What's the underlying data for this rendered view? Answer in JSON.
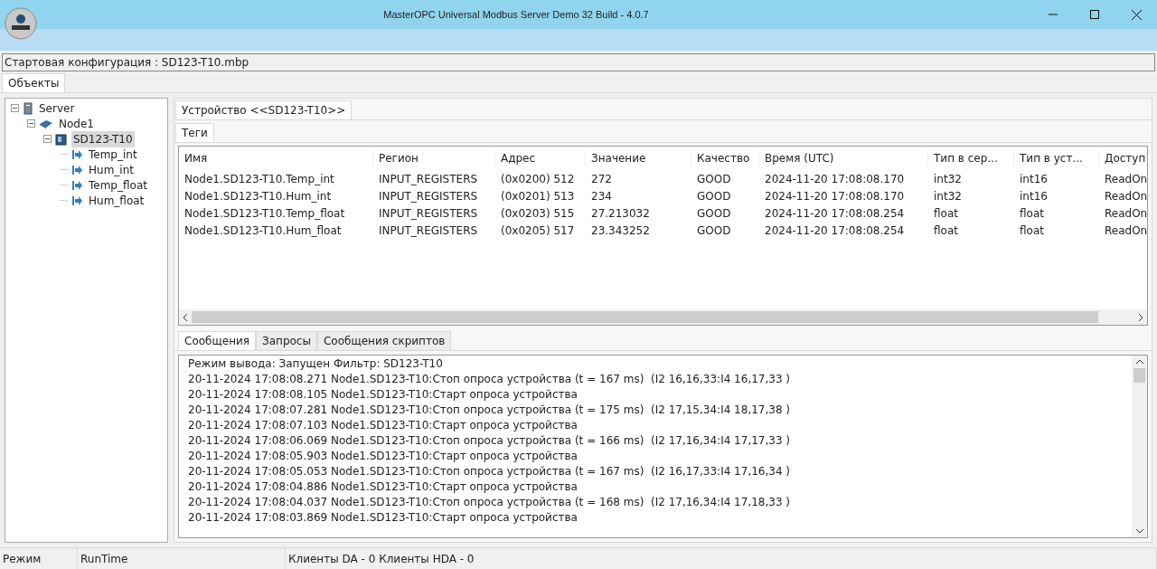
{
  "window": {
    "title": "MasterOPC Universal Modbus Server Demo 32 Build - 4.0.7"
  },
  "config_line": "Стартовая конфигурация : SD123-T10.mbp",
  "left_tabs": [
    {
      "label": "Объекты",
      "selected": true
    }
  ],
  "tree": [
    {
      "label": "Server",
      "kind": "server",
      "expanded": true,
      "selected": false,
      "children": [
        {
          "label": "Node1",
          "kind": "node",
          "expanded": true,
          "selected": false,
          "children": [
            {
              "label": "SD123-T10",
              "kind": "device",
              "expanded": true,
              "selected": true,
              "children": [
                {
                  "label": "Temp_int",
                  "kind": "tag",
                  "selected": false
                },
                {
                  "label": "Hum_int",
                  "kind": "tag",
                  "selected": false
                },
                {
                  "label": "Temp_float",
                  "kind": "tag",
                  "selected": false
                },
                {
                  "label": "Hum_float",
                  "kind": "tag",
                  "selected": false
                }
              ]
            }
          ]
        }
      ]
    }
  ],
  "device_tabs": [
    {
      "label": "Устройство <<SD123-T10>>",
      "selected": true
    }
  ],
  "tag_tabs": [
    {
      "label": "Теги",
      "selected": true
    }
  ],
  "table": {
    "columns": [
      "Имя",
      "Регион",
      "Адрес",
      "Значение",
      "Качество",
      "Время (UTC)",
      "Тип в сер...",
      "Тип в уст...",
      "Доступ"
    ],
    "rows": [
      [
        "Node1.SD123-T10.Temp_int",
        "INPUT_REGISTERS",
        "(0x0200) 512",
        "272",
        "GOOD",
        "2024-11-20 17:08:08.170",
        "int32",
        "int16",
        "ReadOn"
      ],
      [
        "Node1.SD123-T10.Hum_int",
        "INPUT_REGISTERS",
        "(0x0201) 513",
        "234",
        "GOOD",
        "2024-11-20 17:08:08.170",
        "int32",
        "int16",
        "ReadOn"
      ],
      [
        "Node1.SD123-T10.Temp_float",
        "INPUT_REGISTERS",
        "(0x0203) 515",
        "27.213032",
        "GOOD",
        "2024-11-20 17:08:08.254",
        "float",
        "float",
        "ReadOn"
      ],
      [
        "Node1.SD123-T10.Hum_float",
        "INPUT_REGISTERS",
        "(0x0205) 517",
        "23.343252",
        "GOOD",
        "2024-11-20 17:08:08.254",
        "float",
        "float",
        "ReadOn"
      ]
    ]
  },
  "log_tabs": [
    {
      "label": "Сообщения",
      "selected": true
    },
    {
      "label": "Запросы",
      "selected": false
    },
    {
      "label": "Сообщения скриптов",
      "selected": false
    }
  ],
  "log": {
    "header": "Режим вывода: Запущен Фильтр: SD123-T10",
    "lines": [
      "20-11-2024 17:08:08.271 Node1.SD123-T10:Стоп опроса устройства (t = 167 ms)  (I2 16,16,33:I4 16,17,33 )",
      "20-11-2024 17:08:08.105 Node1.SD123-T10:Старт опроса устройства",
      "20-11-2024 17:08:07.281 Node1.SD123-T10:Стоп опроса устройства (t = 175 ms)  (I2 17,15,34:I4 18,17,38 )",
      "20-11-2024 17:08:07.103 Node1.SD123-T10:Старт опроса устройства",
      "20-11-2024 17:08:06.069 Node1.SD123-T10:Стоп опроса устройства (t = 166 ms)  (I2 17,16,34:I4 17,17,33 )",
      "20-11-2024 17:08:05.903 Node1.SD123-T10:Старт опроса устройства",
      "20-11-2024 17:08:05.053 Node1.SD123-T10:Стоп опроса устройства (t = 167 ms)  (I2 16,17,33:I4 17,16,34 )",
      "20-11-2024 17:08:04.886 Node1.SD123-T10:Старт опроса устройства",
      "20-11-2024 17:08:04.037 Node1.SD123-T10:Стоп опроса устройства (t = 168 ms)  (I2 17,16,34:I4 17,18,33 )",
      "20-11-2024 17:08:03.869 Node1.SD123-T10:Старт опроса устройства"
    ]
  },
  "status_bar": [
    "Режим",
    "RunTime",
    "Клиенты DA - 0 Клиенты HDA - 0"
  ]
}
